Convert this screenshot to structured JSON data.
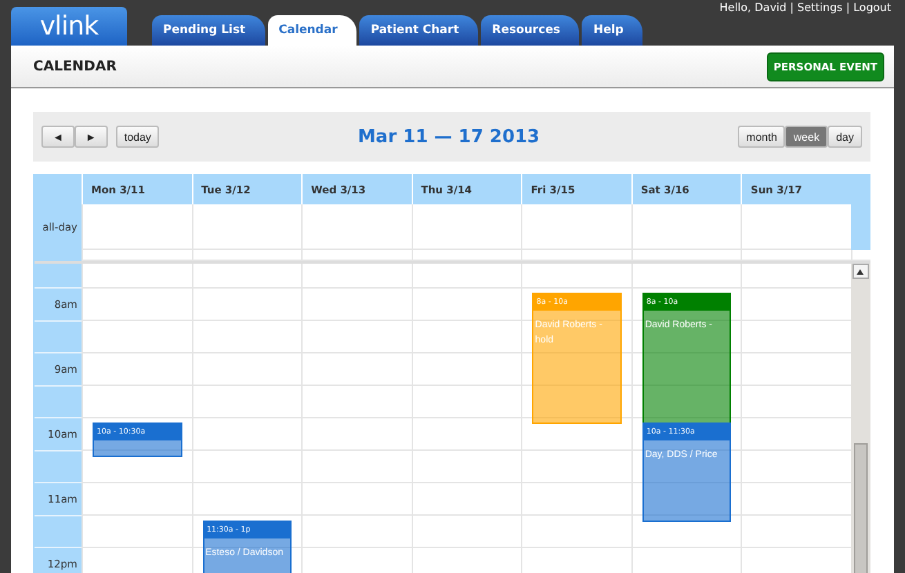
{
  "logo": "vlink",
  "user_links": "Hello, David | Settings | Logout",
  "tabs": [
    {
      "label": "Pending List",
      "selected": false
    },
    {
      "label": "Calendar",
      "selected": true
    },
    {
      "label": "Patient Chart",
      "selected": false
    },
    {
      "label": "Resources",
      "selected": false
    },
    {
      "label": "Help",
      "selected": false
    }
  ],
  "page_title": "CALENDAR",
  "personal_event_button": "PERSONAL EVENT",
  "toolbar": {
    "prev": "◄",
    "next": "►",
    "today": "today",
    "range": "Mar 11 — 17 2013",
    "views": [
      {
        "label": "month",
        "selected": false
      },
      {
        "label": "week",
        "selected": true
      },
      {
        "label": "day",
        "selected": false
      }
    ]
  },
  "all_day_label": "all-day",
  "days": [
    {
      "label": "Mon 3/11",
      "events": [
        {
          "time": "10a - 10:30a",
          "color": "#1a6fd0"
        }
      ]
    },
    {
      "label": "Tue 3/12",
      "events": [
        {
          "time": "11:30a - 1p",
          "title": "Esteso / Davidson",
          "color": "#1a6fd0"
        }
      ]
    },
    {
      "label": "Wed 3/13"
    },
    {
      "label": "Thu 3/14"
    },
    {
      "label": "Fri 3/15",
      "events": [
        {
          "time": "8a - 10a",
          "title": "David Roberts - hold",
          "color": "#ffa500"
        }
      ]
    },
    {
      "label": "Sat 3/16",
      "events": [
        {
          "time": "8a - 10a",
          "title": "David Roberts -",
          "color": "#008000"
        },
        {
          "time": "10a - 11:30a",
          "title": "Day, DDS / Price",
          "color": "#1a6fd0"
        }
      ]
    },
    {
      "label": "Sun 3/17"
    }
  ],
  "hours": [
    "8am",
    "9am",
    "10am",
    "11am",
    "12pm"
  ]
}
